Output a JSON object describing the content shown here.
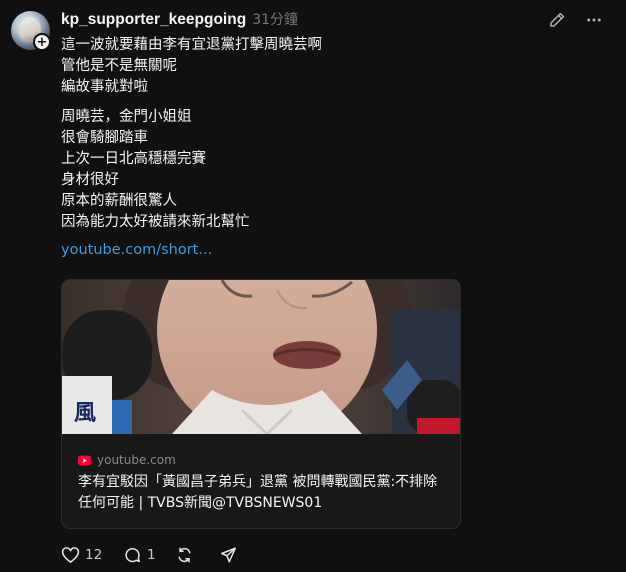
{
  "post": {
    "username": "kp_supporter_keepgoing",
    "timestamp": "31分鐘",
    "paragraph1": [
      "這一波就要藉由李有宜退黨打擊周曉芸啊",
      "管他是不是無關呢",
      "編故事就對啦"
    ],
    "paragraph2": [
      "周曉芸，金門小姐姐",
      "很會騎腳踏車",
      "上次一日北高穩穩完賽",
      "身材很好",
      "原本的薪酬很驚人",
      "因為能力太好被請來新北幫忙"
    ],
    "link_text": "youtube.com/short..."
  },
  "card": {
    "domain": "youtube.com",
    "title": "李有宜駁因「黃國昌子弟兵」退黨 被問轉戰國民黨:不排除任何可能 | TVBS新聞@TVBSNEWS01"
  },
  "actions": {
    "like_count": "12",
    "reply_count": "1"
  },
  "colors": {
    "background": "#101010",
    "text": "#f3f5f7",
    "muted": "#777777",
    "link": "#3f9be6",
    "youtube_red": "#ff0033"
  },
  "icons": [
    "follow-plus-icon",
    "edit-icon",
    "more-icon",
    "youtube-icon",
    "heart-icon",
    "comment-icon",
    "repost-icon",
    "share-icon"
  ]
}
